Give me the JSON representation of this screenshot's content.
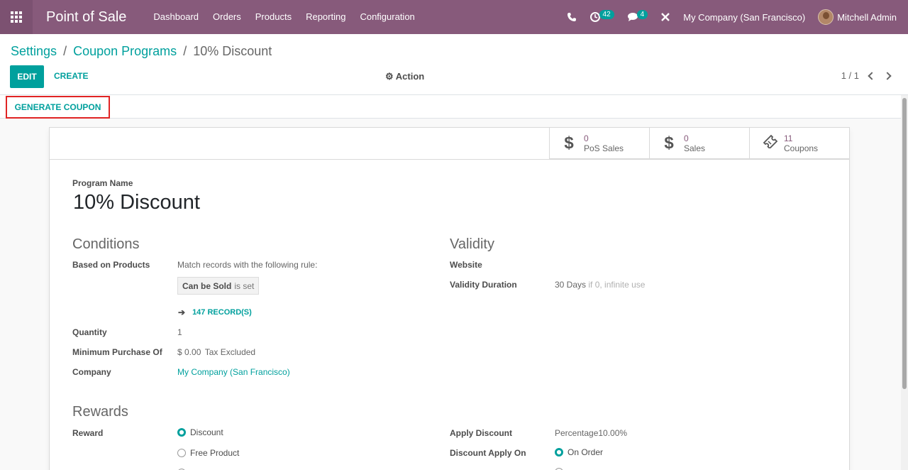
{
  "navbar": {
    "app_name": "Point of Sale",
    "menu": [
      "Dashboard",
      "Orders",
      "Products",
      "Reporting",
      "Configuration"
    ],
    "activity_count": "42",
    "message_count": "4",
    "company": "My Company (San Francisco)",
    "user": "Mitchell Admin"
  },
  "breadcrumb": {
    "settings": "Settings",
    "separator": "/",
    "programs": "Coupon Programs",
    "current": "10% Discount"
  },
  "toolbar": {
    "edit_label": "EDIT",
    "create_label": "CREATE",
    "action_label": "Action",
    "pager": "1 / 1"
  },
  "statusbar": {
    "generate_label": "GENERATE COUPON"
  },
  "stat_buttons": [
    {
      "value": "0",
      "label": "PoS Sales",
      "icon": "dollar-icon"
    },
    {
      "value": "0",
      "label": "Sales",
      "icon": "dollar-icon"
    },
    {
      "value": "11",
      "label": "Coupons",
      "icon": "ticket-icon"
    }
  ],
  "form": {
    "program_name_label": "Program Name",
    "program_name": "10% Discount",
    "conditions": {
      "title": "Conditions",
      "based_on_products_label": "Based on Products",
      "rule_text": "Match records with the following rule:",
      "domain_field": "Can be Sold",
      "domain_operator": "is set",
      "records": "147 RECORD(S)",
      "quantity_label": "Quantity",
      "quantity": "1",
      "min_purchase_label": "Minimum Purchase Of",
      "min_purchase": "$ 0.00",
      "tax_mode": "Tax Excluded",
      "company_label": "Company",
      "company": "My Company (San Francisco)"
    },
    "validity": {
      "title": "Validity",
      "website_label": "Website",
      "duration_label": "Validity Duration",
      "duration": "30 Days",
      "duration_hint": "if 0, infinite use"
    },
    "rewards": {
      "title": "Rewards",
      "reward_label": "Reward",
      "options": [
        "Discount",
        "Free Product"
      ],
      "selected": "Discount",
      "apply_discount_label": "Apply Discount",
      "apply_discount": "Percentage10.00%",
      "discount_apply_on_label": "Discount Apply On",
      "apply_on_selected": "On Order"
    }
  },
  "colors": {
    "navbar": "#875a7b",
    "accent": "#00a09d",
    "highlight_border": "#e02424"
  }
}
